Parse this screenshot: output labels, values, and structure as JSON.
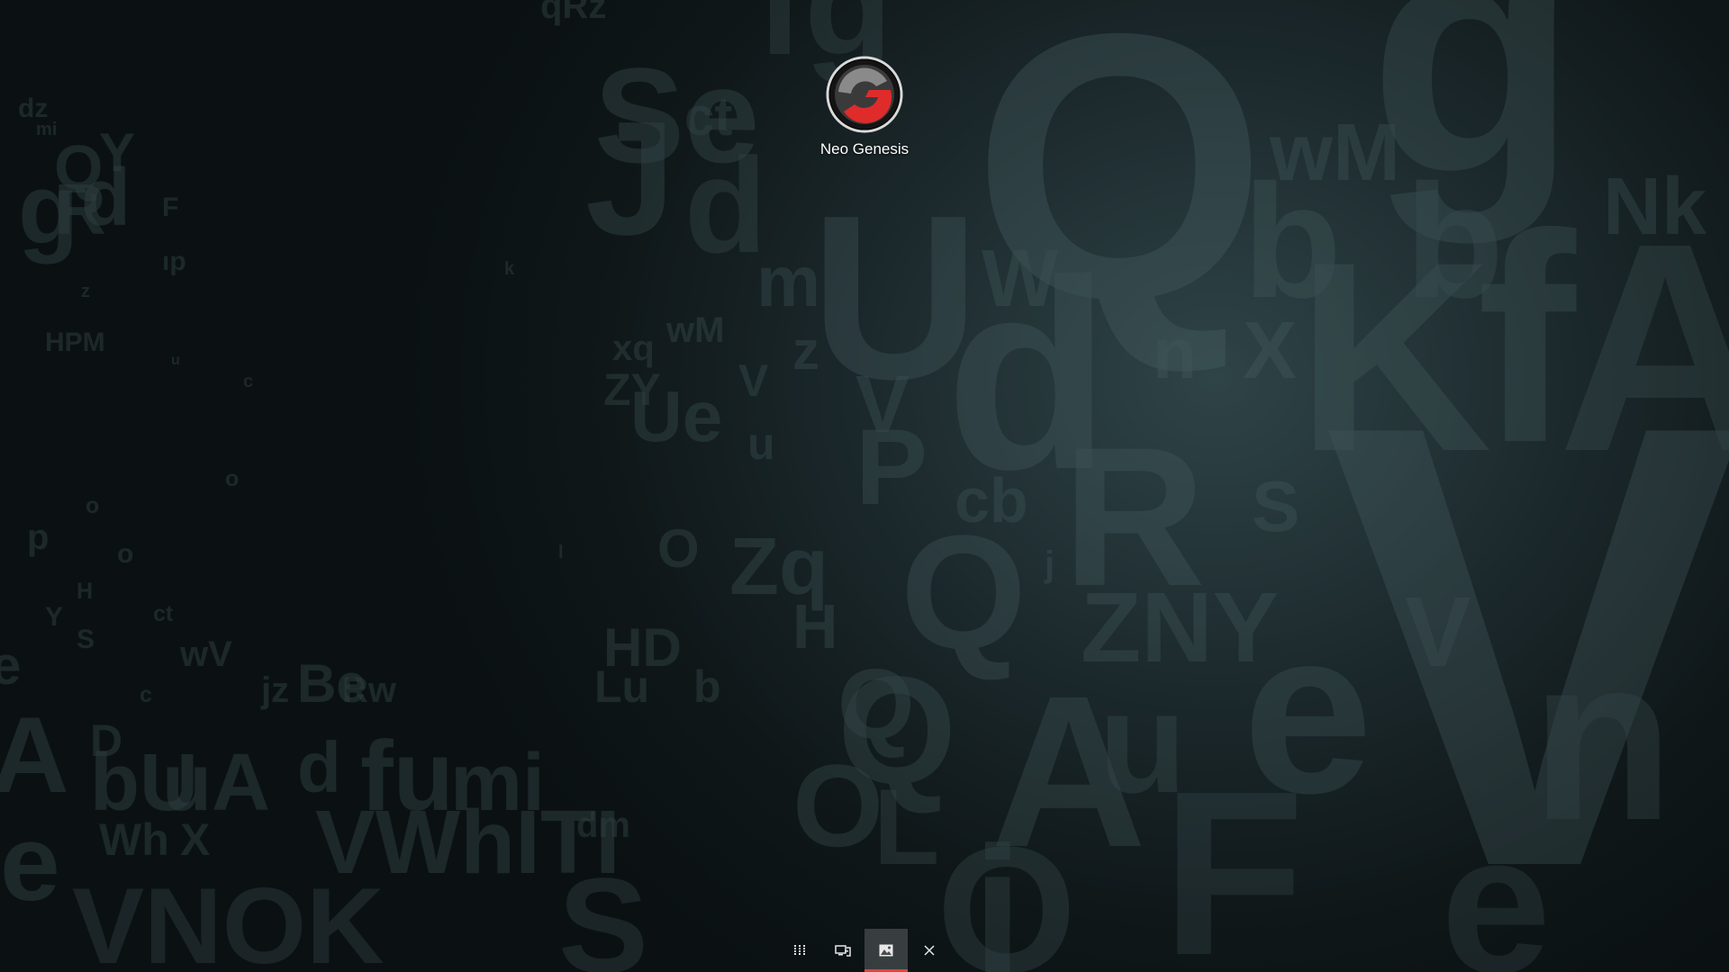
{
  "desktop": {
    "shortcuts": [
      {
        "label": "Neo Genesis",
        "icon": "neo-genesis-logo-icon"
      }
    ]
  },
  "taskbar": {
    "buttons": [
      {
        "icon": "app-grid-icon",
        "active": false
      },
      {
        "icon": "display-switch-icon",
        "active": false
      },
      {
        "icon": "image-icon",
        "active": true
      },
      {
        "icon": "close-icon",
        "active": false
      }
    ],
    "accent": "#e0453a"
  },
  "colors": {
    "background": "#0b1113",
    "wallpaper_letters": "#4e6669",
    "logo_red": "#e02b2b"
  }
}
